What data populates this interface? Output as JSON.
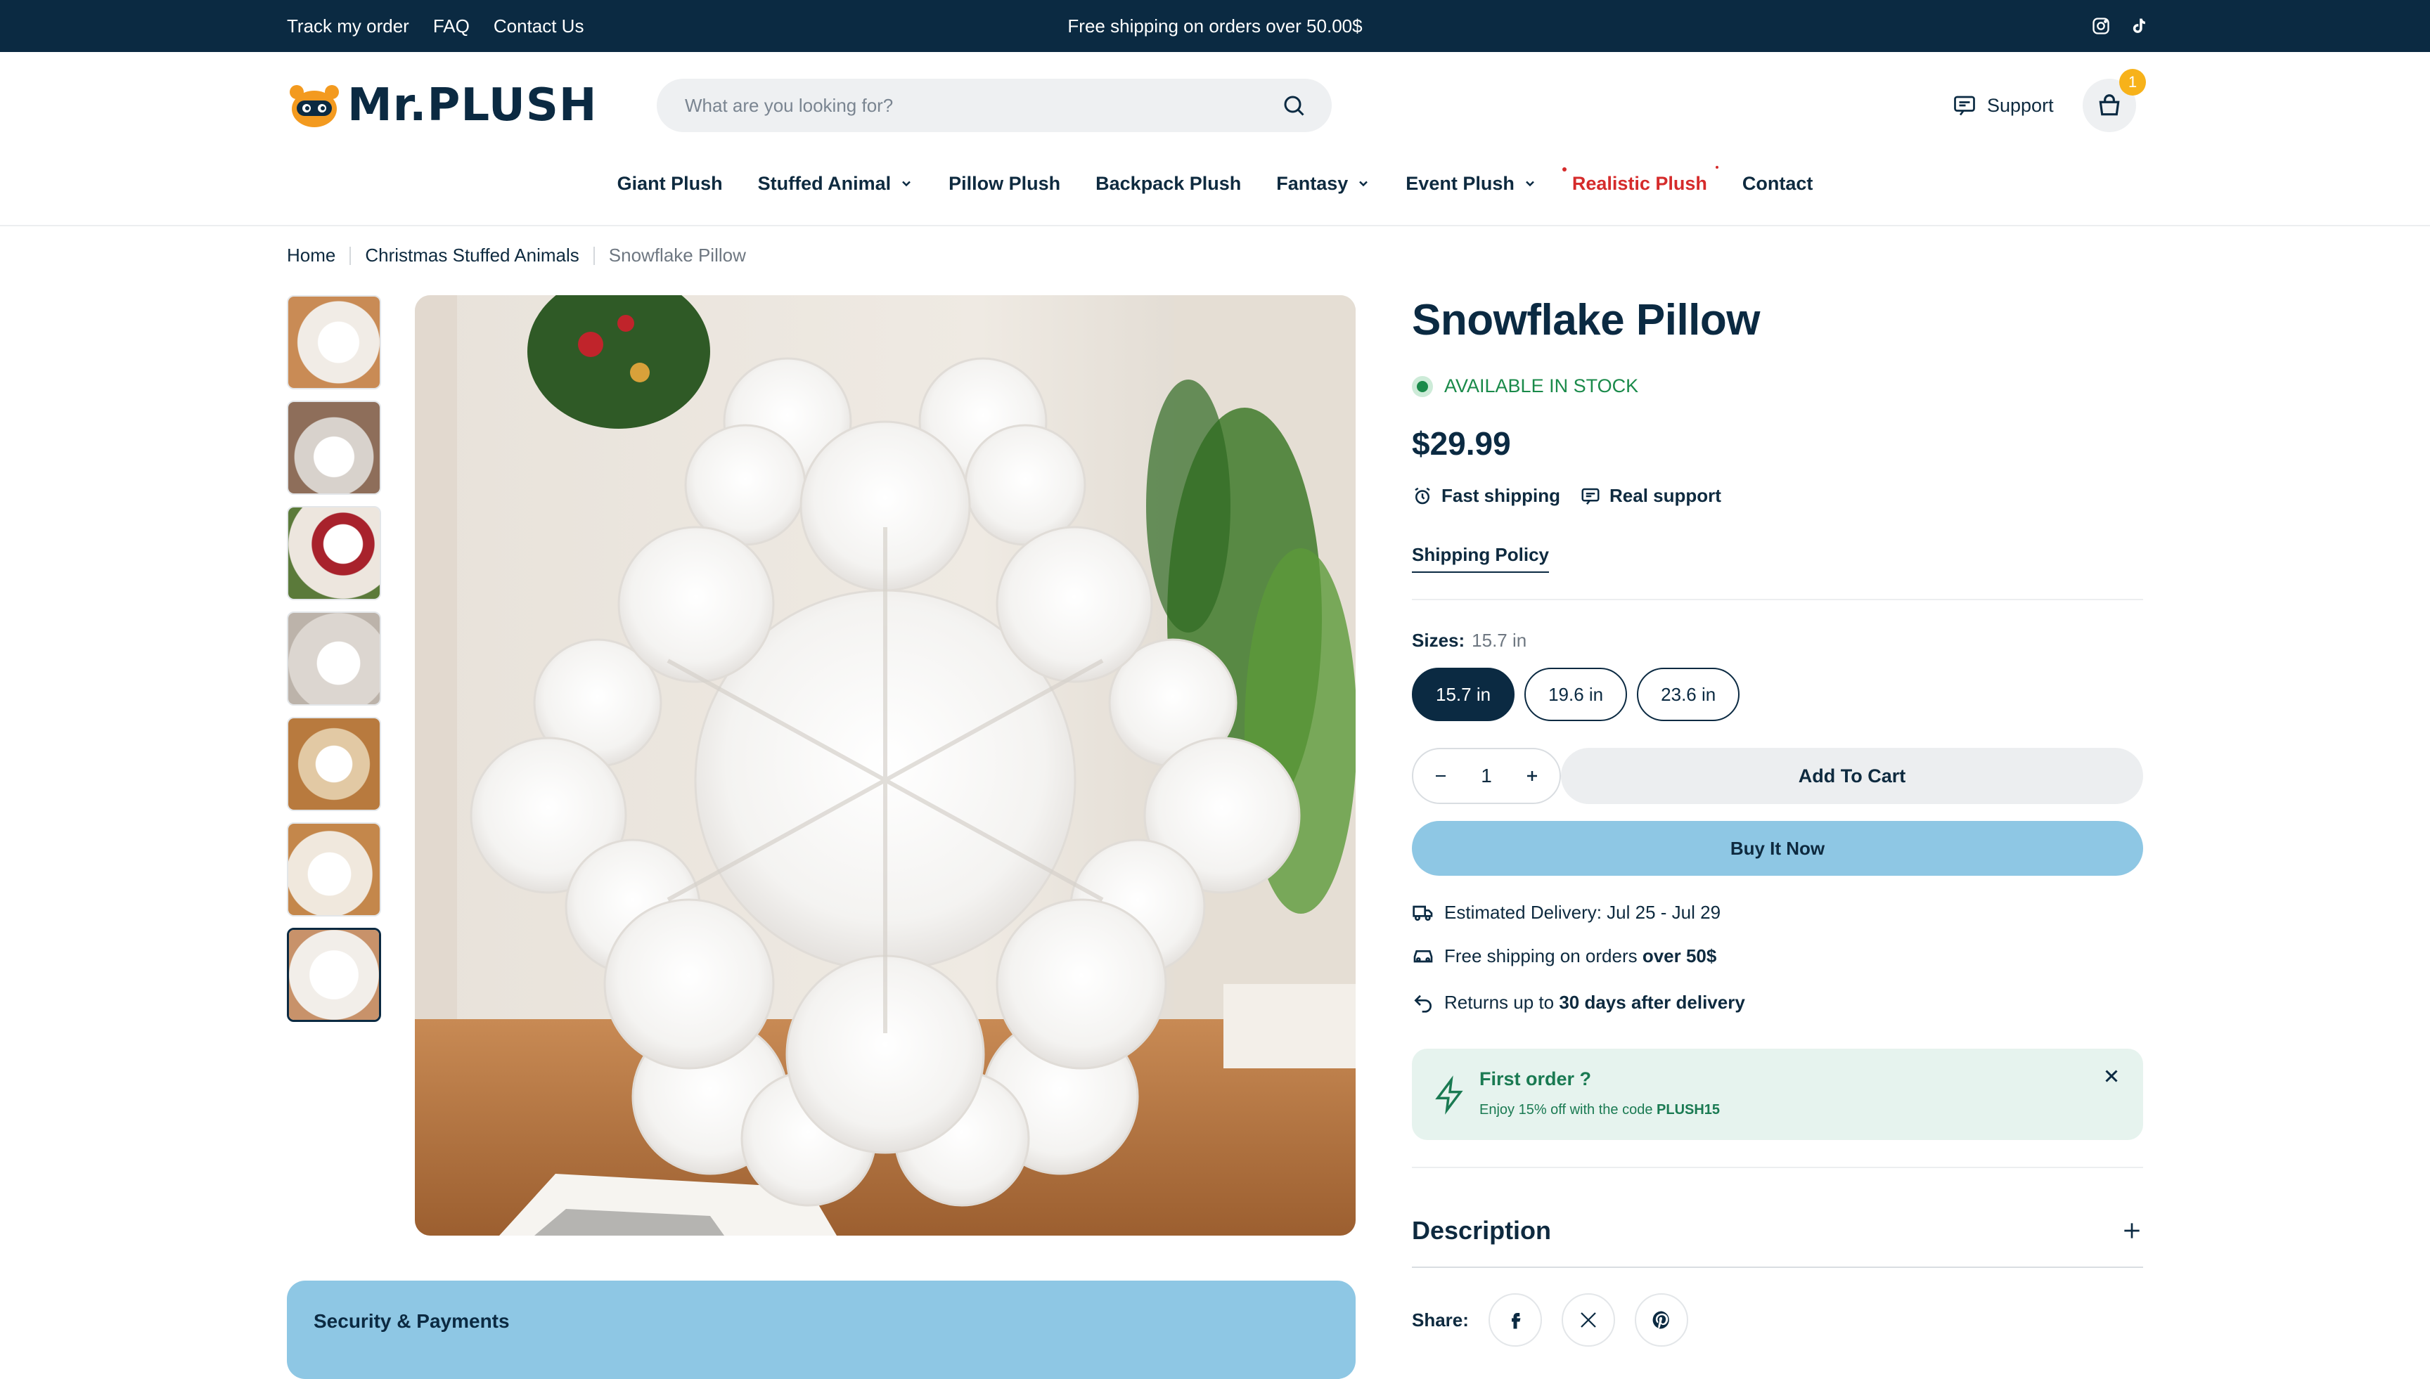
{
  "topbar": {
    "links": [
      "Track my order",
      "FAQ",
      "Contact Us"
    ],
    "promo": "Free shipping on orders over 50.00$",
    "social_icons": [
      "instagram-icon",
      "tiktok-icon"
    ]
  },
  "header": {
    "logo_text": "Mr.PLUSH",
    "search_placeholder": "What are you looking for?",
    "support_label": "Support",
    "cart_count": "1"
  },
  "nav": {
    "items": [
      {
        "label": "Giant Plush",
        "dropdown": false
      },
      {
        "label": "Stuffed Animal",
        "dropdown": true
      },
      {
        "label": "Pillow Plush",
        "dropdown": false
      },
      {
        "label": "Backpack Plush",
        "dropdown": false
      },
      {
        "label": "Fantasy",
        "dropdown": true
      },
      {
        "label": "Event Plush",
        "dropdown": true
      },
      {
        "label": "Realistic Plush",
        "dropdown": false,
        "highlight": "#d52b2b"
      },
      {
        "label": "Contact",
        "dropdown": false
      }
    ]
  },
  "breadcrumb": [
    "Home",
    "Christmas Stuffed Animals",
    "Snowflake Pillow"
  ],
  "gallery": {
    "thumbnail_count": 7,
    "active_index": 6
  },
  "security": {
    "title": "Security & Payments"
  },
  "product": {
    "title": "Snowflake Pillow",
    "stock": "AVAILABLE IN STOCK",
    "price": "$29.99",
    "perks": [
      "Fast shipping",
      "Real support"
    ],
    "policy_link": "Shipping Policy",
    "sizes_label": "Sizes:",
    "selected_size": "15.7 in",
    "sizes": [
      "15.7 in",
      "19.6 in",
      "23.6 in"
    ],
    "quantity": "1",
    "add_to_cart": "Add To Cart",
    "buy_now": "Buy It Now"
  },
  "shipping": {
    "delivery": "Estimated Delivery: Jul 25 - Jul 29",
    "free_prefix": "Free shipping on orders ",
    "free_bold": "over 50$",
    "returns_prefix": "Returns up to ",
    "returns_bold": "30 days after delivery"
  },
  "first_order": {
    "title": "First order ?",
    "text_prefix": "Enjoy 15% off with the code ",
    "code": "PLUSH15"
  },
  "description": {
    "label": "Description"
  },
  "share": {
    "label": "Share:",
    "icons": [
      "facebook-icon",
      "x-icon",
      "pinterest-icon"
    ]
  },
  "colors": {
    "navy": "#0b2a42",
    "accent_blue": "#8ec7e4",
    "stock_green": "#1a8a4a",
    "badge_yellow": "#f7b21a",
    "highlight_red": "#d52b2b"
  }
}
